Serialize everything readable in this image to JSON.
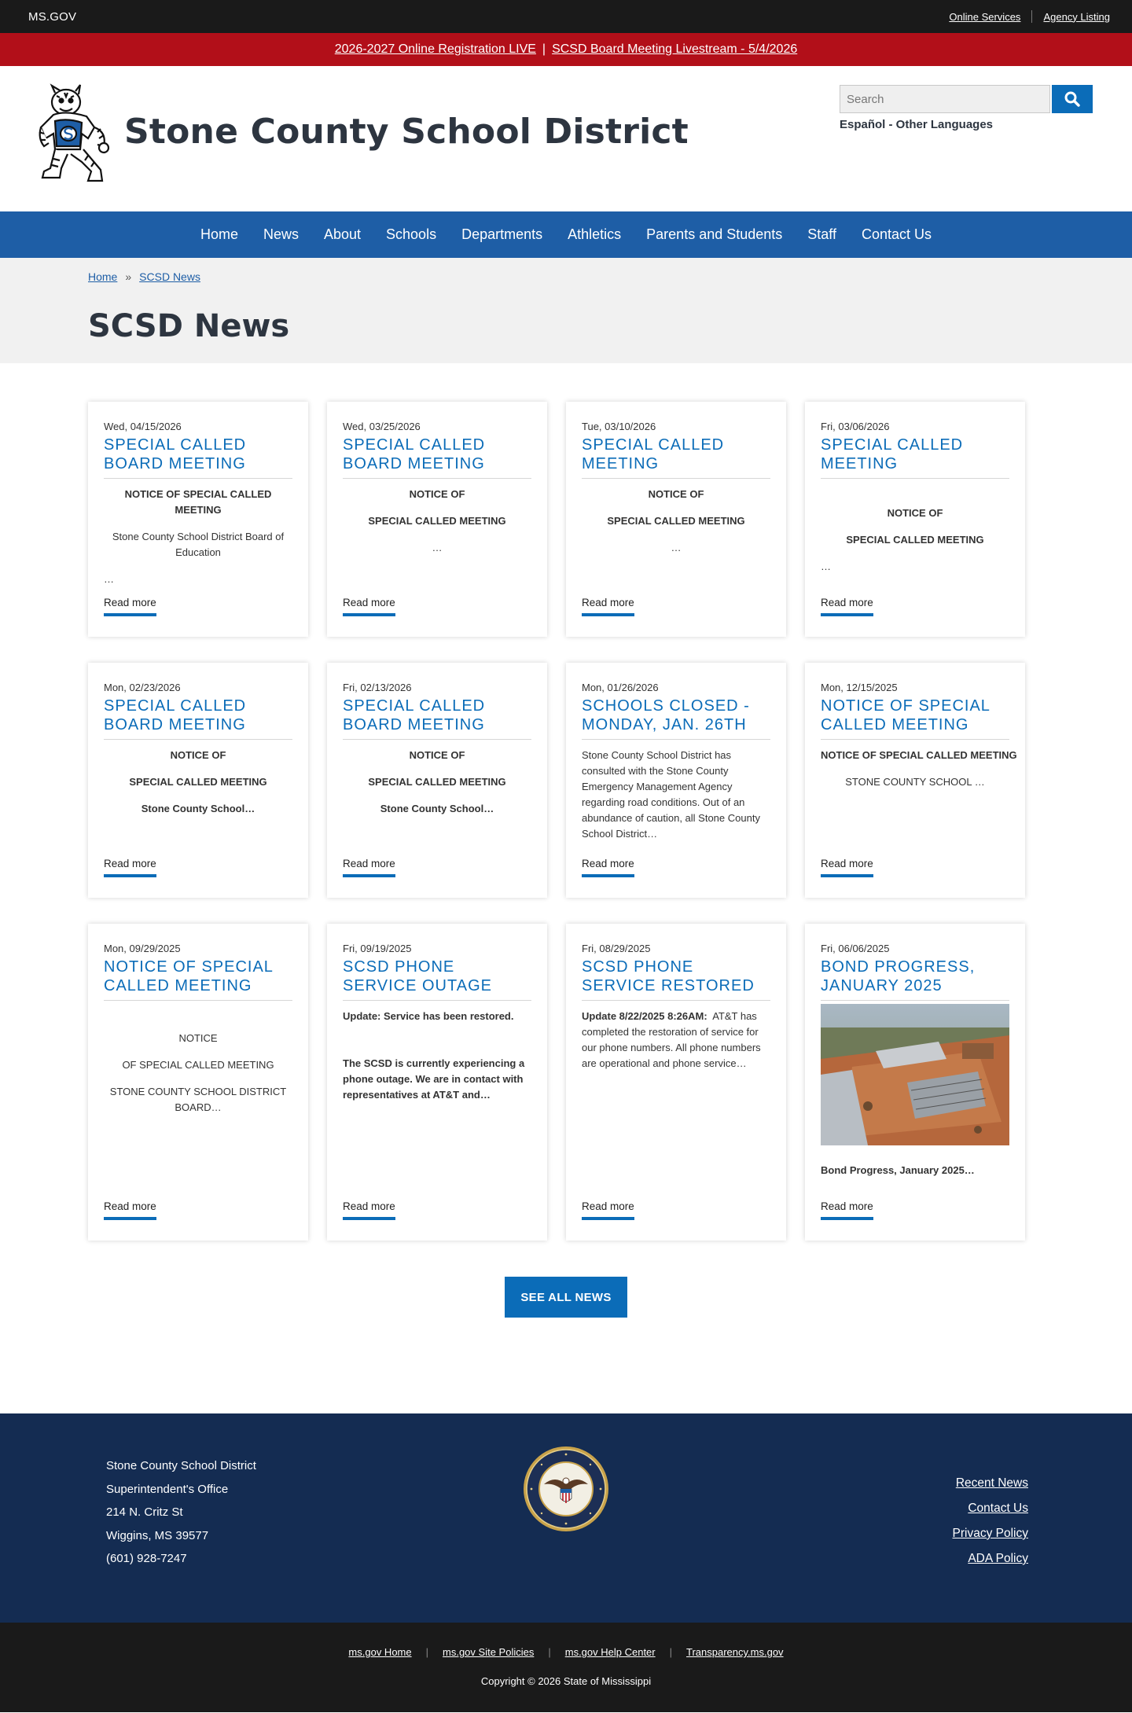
{
  "topbar": {
    "brand": "MS.GOV",
    "links": [
      "Online Services",
      "Agency Listing"
    ]
  },
  "alert": {
    "link1": "2026-2027 Online Registration LIVE",
    "separator": "|",
    "link2": "SCSD Board Meeting Livestream - 5/4/2026"
  },
  "header": {
    "title": "Stone County School District",
    "search_placeholder": "Search",
    "language_link": "Español - Other Languages",
    "logo_icon": "tiger-mascot-logo",
    "search_icon": "magnifying-glass-icon"
  },
  "nav": {
    "items": [
      "Home",
      "News",
      "About",
      "Schools",
      "Departments",
      "Athletics",
      "Parents and Students",
      "Staff",
      "Contact Us"
    ]
  },
  "breadcrumb": {
    "home": "Home",
    "separator": "»",
    "current": "SCSD News"
  },
  "page_title": "SCSD News",
  "cards": [
    {
      "date": "Wed, 04/15/2026",
      "title": "Special Called Board Meeting",
      "lines": [
        "NOTICE OF SPECIAL CALLED MEETING",
        "Stone County School District Board of Education",
        "…"
      ],
      "read_more": "Read more"
    },
    {
      "date": "Wed, 03/25/2026",
      "title": "Special Called Board Meeting",
      "lines": [
        "NOTICE OF",
        "SPECIAL CALLED MEETING",
        "…"
      ],
      "read_more": "Read more"
    },
    {
      "date": "Tue, 03/10/2026",
      "title": "Special Called Meeting",
      "lines": [
        "NOTICE OF",
        "SPECIAL CALLED MEETING",
        "…"
      ],
      "read_more": "Read more"
    },
    {
      "date": "Fri, 03/06/2026",
      "title": "Special Called Meeting",
      "lines": [
        "NOTICE OF",
        "SPECIAL CALLED MEETING",
        "…"
      ],
      "read_more": "Read more"
    },
    {
      "date": "Mon, 02/23/2026",
      "title": "Special Called Board Meeting",
      "lines": [
        "NOTICE OF",
        "SPECIAL CALLED MEETING",
        "Stone County School…"
      ],
      "read_more": "Read more"
    },
    {
      "date": "Fri, 02/13/2026",
      "title": "Special Called Board Meeting",
      "lines": [
        "NOTICE OF",
        "SPECIAL CALLED MEETING",
        "Stone County School…"
      ],
      "read_more": "Read more"
    },
    {
      "date": "Mon, 01/26/2026",
      "title": "Schools Closed - Monday, Jan. 26th",
      "lines": [
        "Stone County School District has consulted with the Stone County Emergency Management Agency regarding road conditions.  Out of an abundance of caution, all Stone County School District…"
      ],
      "read_more": "Read more"
    },
    {
      "date": "Mon, 12/15/2025",
      "title": "Notice of Special Called Meeting",
      "lines": [
        "NOTICE OF SPECIAL CALLED MEETING",
        "STONE COUNTY SCHOOL …"
      ],
      "read_more": "Read more"
    },
    {
      "date": "Mon, 09/29/2025",
      "title": "Notice of Special Called Meeting",
      "lines": [
        "NOTICE",
        "OF SPECIAL CALLED MEETING",
        "STONE COUNTY SCHOOL DISTRICT BOARD…"
      ],
      "read_more": "Read more"
    },
    {
      "date": "Fri, 09/19/2025",
      "title": "SCSD Phone Service Outage",
      "lines": [
        "Update:  Service has been restored.",
        "The SCSD is currently experiencing a phone outage.  We are in contact with representatives at AT&T and…"
      ],
      "read_more": "Read more"
    },
    {
      "date": "Fri, 08/29/2025",
      "title": "SCSD Phone Service Restored",
      "lines": [
        "Update 8/22/2025 8:26AM:",
        "AT&T has completed the restoration of service for our phone numbers.  All phone numbers are operational and phone service…"
      ],
      "read_more": "Read more"
    },
    {
      "date": "Fri, 06/06/2025",
      "title": "Bond Progress, January 2025",
      "lines": [
        "Bond Progress, January 2025…"
      ],
      "read_more": "Read more",
      "image": "aerial-construction-site-photo"
    }
  ],
  "see_all": "SEE ALL NEWS",
  "footer": {
    "address": [
      "Stone County School District",
      "Superintendent's Office",
      "214 N. Critz St",
      "Wiggins, MS  39577",
      "(601) 928-7247"
    ],
    "seal_icon": "mississippi-state-seal",
    "links": [
      "Recent News",
      "Contact Us",
      "Privacy Policy",
      "ADA Policy"
    ]
  },
  "subfooter": {
    "links": [
      "ms.gov Home",
      "ms.gov Site Policies",
      "ms.gov Help Center",
      "Transparency.ms.gov"
    ],
    "separator": "|",
    "copyright": "Copyright © 2026 State of Mississippi"
  },
  "colors": {
    "topbar": "#1a1a1a",
    "alert": "#b20f19",
    "nav": "#1e5ea6",
    "accent": "#0b6cb8",
    "footer": "#142c52"
  }
}
